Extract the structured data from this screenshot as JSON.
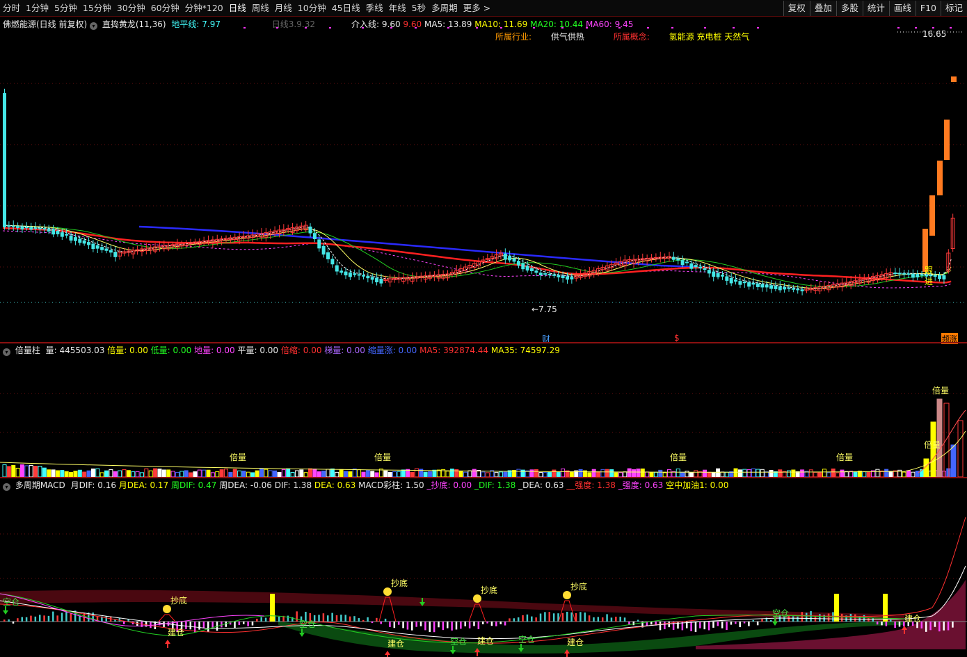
{
  "toolbar": {
    "items": [
      "分时",
      "1分钟",
      "5分钟",
      "15分钟",
      "30分钟",
      "60分钟",
      "分钟*120",
      "日线",
      "周线",
      "月线",
      "10分钟",
      "45日线",
      "季线",
      "年线",
      "5秒",
      "多周期",
      "更多"
    ],
    "active_index": 7,
    "more_arrow": ">",
    "right_buttons": [
      "复权",
      "叠加",
      "多股",
      "统计",
      "画线",
      "F10",
      "标记"
    ]
  },
  "price_panel": {
    "stock_title": "佛燃能源(日线 前复权)",
    "indicator_name": "直捣黄龙(11,36)",
    "ground_line": "地平线: 7.97",
    "faint_label": "日线3.9.32",
    "entry_line_label": "介入线:",
    "entry_line_value1": "9.60",
    "entry_line_value2": "9.60",
    "ma5": "MA5: 13.89",
    "ma10": "MA10: 11.69",
    "ma20": "MA20: 10.44",
    "ma60": "MA60: 9.45",
    "industry_label": "所属行业:",
    "industry_value": "供气供热",
    "concept_label": "所属概念:",
    "concept_value": "氢能源 充电桩 天然气",
    "high_price_label": "16.65",
    "low_price_label": "←7.75",
    "signal_label": "跟进",
    "marker_cai": "财",
    "marker_dollar": "$",
    "marker_limit": "频涨"
  },
  "volume_panel": {
    "title": "倍量柱",
    "vol": "量: 445503.03",
    "double": "倍量: 0.00",
    "low": "低量: 0.00",
    "ground": "地量: 0.00",
    "flat": "平量: 0.00",
    "shrink": "倍缩: 0.00",
    "ladder": "梯量: 0.00",
    "shrink_up": "缩量涨: 0.00",
    "ma5": "MA5: 392874.44",
    "ma35": "MA35: 74597.29",
    "bar_label": "倍量",
    "bar_label2": "倍量"
  },
  "macd_panel": {
    "title": "多周期MACD",
    "month_dif": "月DIF: 0.16",
    "month_dea": "月DEA: 0.17",
    "week_dif": "周DIF: 0.47",
    "week_dea": "周DEA: -0.06",
    "dif": "DIF: 1.38",
    "dea": "DEA: 0.63",
    "macd_bar": "MACD彩柱: 1.50",
    "bottom": "_抄底: 0.00",
    "dif2": "_DIF: 1.38",
    "dea2": "_DEA: 0.63",
    "strength": "__强度: 1.38",
    "strength2": "_强度: 0.63",
    "air_add": "空中加油1: 0.00",
    "label_bottom": "抄底",
    "label_build": "建仓",
    "label_empty": "空仓"
  },
  "colors": {
    "up": "#ff3a3a",
    "down": "#44e6e6",
    "bg": "#000000",
    "divider": "#8a1010",
    "blue_line": "#2a2aff",
    "yellow_line": "#ffff66",
    "green_line": "#22cc22"
  }
}
